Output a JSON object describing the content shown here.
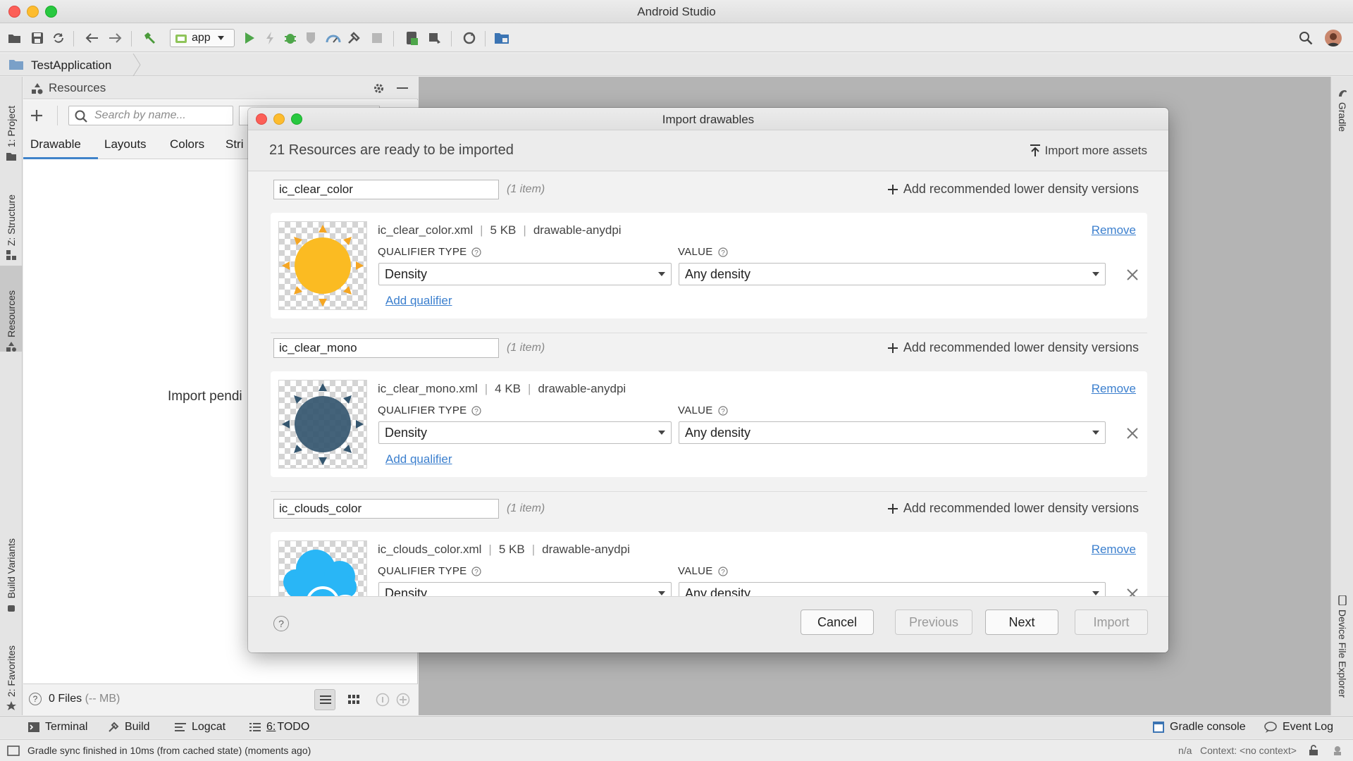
{
  "window": {
    "title": "Android Studio"
  },
  "toolbar": {
    "run_config": "app"
  },
  "breadcrumb": {
    "project": "TestApplication"
  },
  "left_strip": {
    "tabs": [
      "1: Project",
      "Z: Structure",
      "Resources",
      "Build Variants",
      "2: Favorites"
    ]
  },
  "right_strip": {
    "tabs": [
      "Gradle",
      "Device File Explorer"
    ]
  },
  "resources_panel": {
    "title": "Resources",
    "search_placeholder": "Search by name...",
    "tabs": [
      "Drawable",
      "Layouts",
      "Colors",
      "Stri"
    ],
    "pending_text": "Import pendi",
    "footer_files": "0 Files",
    "footer_size": "(-- MB)"
  },
  "dialog": {
    "title": "Import drawables",
    "ready_text": "21 Resources are ready to be imported",
    "import_more": "Import more assets",
    "add_recommended": "Add recommended lower density versions",
    "qualifier_type_label": "QUALIFIER TYPE",
    "value_label": "VALUE",
    "remove_label": "Remove",
    "add_qualifier_label": "Add qualifier",
    "groups": [
      {
        "name": "ic_clear_color",
        "count": "(1 item)",
        "file": "ic_clear_color.xml",
        "size": "5 KB",
        "folder": "drawable-anydpi",
        "qualifier": "Density",
        "value": "Any density",
        "icon": "sun-color-icon"
      },
      {
        "name": "ic_clear_mono",
        "count": "(1 item)",
        "file": "ic_clear_mono.xml",
        "size": "4 KB",
        "folder": "drawable-anydpi",
        "qualifier": "Density",
        "value": "Any density",
        "icon": "sun-mono-icon"
      },
      {
        "name": "ic_clouds_color",
        "count": "(1 item)",
        "file": "ic_clouds_color.xml",
        "size": "5 KB",
        "folder": "drawable-anydpi",
        "qualifier": "Density",
        "value": "Any density",
        "icon": "clouds-color-icon"
      }
    ],
    "buttons": {
      "cancel": "Cancel",
      "previous": "Previous",
      "next": "Next",
      "import": "Import"
    }
  },
  "bottom_tabs": {
    "terminal": "Terminal",
    "build": "Build",
    "logcat": "Logcat",
    "todo": "TODO",
    "todo_prefix": "6:",
    "gradle_console": "Gradle console",
    "event_log": "Event Log"
  },
  "status": {
    "message": "Gradle sync finished in 10ms (from cached state) (moments ago)",
    "na": "n/a",
    "context": "Context: <no context>"
  },
  "colors": {
    "sun": "#fbbb22",
    "sun_rays": "#f5a623",
    "mono": "#34566f",
    "cloud": "#29b6f6",
    "link": "#3b7fce"
  }
}
